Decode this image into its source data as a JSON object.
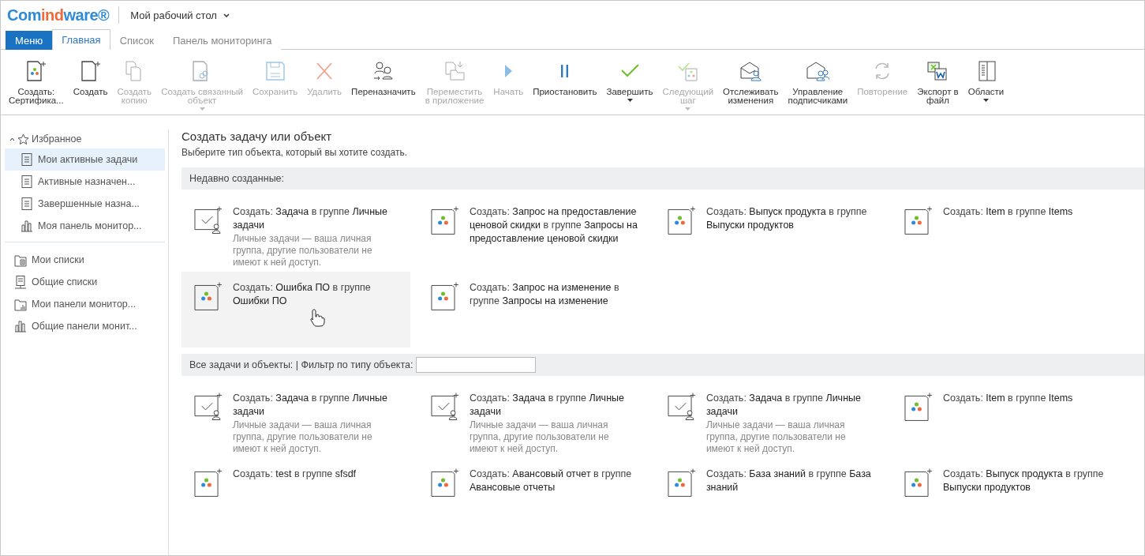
{
  "header": {
    "logo": [
      {
        "text": "Com",
        "color": "#2f8ad8"
      },
      {
        "text": "ind",
        "color": "#ee6a3a"
      },
      {
        "text": "ware®",
        "color": "#2f8ad8"
      }
    ],
    "workspace": "Мой рабочий стол"
  },
  "tabs": [
    {
      "label": "Меню",
      "kind": "menu",
      "selected": false
    },
    {
      "label": "Главная",
      "kind": "tab",
      "selected": true
    },
    {
      "label": "Список",
      "kind": "tab",
      "selected": false
    },
    {
      "label": "Панель мониторинга",
      "kind": "tab",
      "selected": false
    }
  ],
  "toolbar": [
    {
      "kind": "create-object",
      "lines": [
        "Создать:",
        "Сертифика..."
      ],
      "disabled": false,
      "dropdown": false
    },
    {
      "kind": "create",
      "lines": [
        "Создать"
      ],
      "disabled": false,
      "dropdown": false
    },
    {
      "kind": "copy",
      "lines": [
        "Создать",
        "копию"
      ],
      "disabled": true,
      "dropdown": false
    },
    {
      "kind": "link",
      "lines": [
        "Создать связанный",
        "объект"
      ],
      "disabled": true,
      "dropdown": true
    },
    {
      "kind": "save",
      "lines": [
        "Сохранить"
      ],
      "disabled": true,
      "dropdown": false
    },
    {
      "kind": "delete",
      "lines": [
        "Удалить"
      ],
      "disabled": true,
      "dropdown": false
    },
    {
      "kind": "reassign",
      "lines": [
        "Переназначить"
      ],
      "disabled": false,
      "dropdown": false
    },
    {
      "kind": "move",
      "lines": [
        "Переместить",
        "в приложение"
      ],
      "disabled": true,
      "dropdown": false
    },
    {
      "kind": "start",
      "lines": [
        "Начать"
      ],
      "disabled": true,
      "dropdown": false
    },
    {
      "kind": "pause",
      "lines": [
        "Приостановить"
      ],
      "disabled": false,
      "dropdown": false
    },
    {
      "kind": "complete",
      "lines": [
        "Завершить"
      ],
      "disabled": false,
      "dropdown": true
    },
    {
      "kind": "next-step",
      "lines": [
        "Следующий",
        "шаг"
      ],
      "disabled": true,
      "dropdown": true
    },
    {
      "kind": "track",
      "lines": [
        "Отслеживать",
        "изменения"
      ],
      "disabled": false,
      "dropdown": false
    },
    {
      "kind": "subscribers",
      "lines": [
        "Управление",
        "подписчиками"
      ],
      "disabled": false,
      "dropdown": false
    },
    {
      "kind": "repeat",
      "lines": [
        "Повторение"
      ],
      "disabled": true,
      "dropdown": false
    },
    {
      "kind": "export",
      "lines": [
        "Экспорт в",
        "файл"
      ],
      "disabled": false,
      "dropdown": false
    },
    {
      "kind": "areas",
      "lines": [
        "Области"
      ],
      "disabled": false,
      "dropdown": true
    }
  ],
  "sidebar": {
    "favorites": {
      "label": "Избранное",
      "expanded": true,
      "items": [
        {
          "kind": "document",
          "label": "Мои активные задачи",
          "selected": true
        },
        {
          "kind": "document",
          "label": "Активные назначен...",
          "selected": false
        },
        {
          "kind": "document",
          "label": "Завершенные назна...",
          "selected": false
        },
        {
          "kind": "chart",
          "label": "Моя панель монитор...",
          "selected": false
        }
      ]
    },
    "items": [
      {
        "kind": "list-folder",
        "label": "Мои списки",
        "selected": false
      },
      {
        "kind": "list-shared",
        "label": "Общие списки",
        "selected": false
      },
      {
        "kind": "chart-folder",
        "label": "Мои панели монитор...",
        "selected": false
      },
      {
        "kind": "chart",
        "label": "Общие панели монит...",
        "selected": false
      }
    ]
  },
  "main": {
    "title": "Создать задачу или объект",
    "subtitle": "Выберите тип объекта, который вы хотите создать.",
    "recent": {
      "heading": "Недавно созданные:",
      "cards": [
        {
          "kind": "task",
          "text": "Создать: **Задача** в группе **Личные задачи**",
          "description": "Личные задачи — ваша личная группа, другие пользователи не имеют к ней доступ.",
          "hovered": false
        },
        {
          "kind": "object",
          "text": "Создать: **Запрос на предоставление ценовой скидки** в группе **Запросы на предоставление ценовой скидки**",
          "hovered": false
        },
        {
          "kind": "object",
          "text": "Создать: **Выпуск продукта** в группе **Выпуски продуктов**",
          "hovered": false
        },
        {
          "kind": "object",
          "text": "Создать: **Item** в группе **Items**",
          "hovered": false
        },
        {
          "kind": "object",
          "text": "Создать: **Ошибка ПО** в группе **Ошибки ПО**",
          "hovered": true
        },
        {
          "kind": "object",
          "text": "Создать: **Запрос на изменение** в группе **Запросы на изменение**",
          "hovered": false
        }
      ]
    },
    "all": {
      "heading": "Все задачи и объекты: | Фильтр по типу объекта:",
      "cards": [
        {
          "kind": "task",
          "text": "Создать: **Задача** в группе **Личные задачи**",
          "description": "Личные задачи — ваша личная группа, другие пользователи не имеют к ней доступ.",
          "hovered": false
        },
        {
          "kind": "task",
          "text": "Создать: **Задача** в группе **Личные задачи**",
          "description": "Личные задачи — ваша личная группа, другие пользователи не имеют к ней доступ.",
          "hovered": false
        },
        {
          "kind": "task",
          "text": "Создать: **Задача** в группе **Личные задачи**",
          "description": "Личные задачи — ваша личная группа, другие пользователи не имеют к ней доступ.",
          "hovered": false
        },
        {
          "kind": "object",
          "text": "Создать: **Item** в группе **Items**",
          "hovered": false
        },
        {
          "kind": "object",
          "text": "Создать: **test** в группе **sfsdf**",
          "hovered": false
        },
        {
          "kind": "object",
          "text": "Создать: **Авансовый отчет** в группе **Авансовые отчеты**",
          "hovered": false
        },
        {
          "kind": "object",
          "text": "Создать: **База знаний** в группе **База знаний**",
          "hovered": false
        },
        {
          "kind": "object",
          "text": "Создать: **Выпуск продукта** в группе **Выпуски продуктов**",
          "hovered": false
        }
      ]
    }
  }
}
